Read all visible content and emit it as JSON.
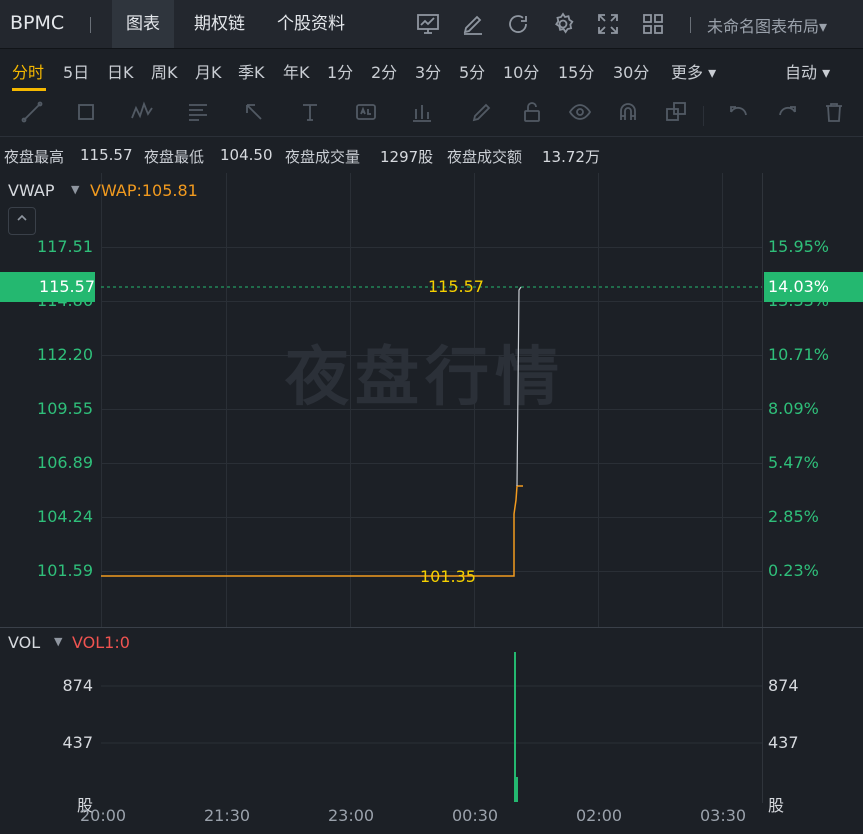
{
  "topbar": {
    "ticker": "BPMC",
    "tabs": [
      "图表",
      "期权链",
      "个股资料"
    ],
    "layout_name": "未命名图表布局▾",
    "icons": [
      "chart-template-icon",
      "edit-icon",
      "refresh-icon",
      "settings-icon",
      "fullscreen-icon",
      "layout-grid-icon"
    ]
  },
  "periods": {
    "items": [
      "分时",
      "5日",
      "日K",
      "周K",
      "月K",
      "季K",
      "年K",
      "1分",
      "2分",
      "3分",
      "5分",
      "10分",
      "15分",
      "30分",
      "更多 ▾"
    ],
    "active": "分时",
    "scale_mode": "自动 ▾"
  },
  "drawing_tools": [
    "line-tool-icon",
    "rectangle-tool-icon",
    "pattern-tool-icon",
    "fibonacci-tool-icon",
    "arrow-tool-icon",
    "text-tool-icon",
    "annotation-tool-icon",
    "measure-tool-icon",
    "brush-tool-icon",
    "lock-icon",
    "eye-icon",
    "magnet-icon",
    "clone-icon",
    "undo-icon",
    "redo-icon",
    "delete-icon"
  ],
  "night_session": {
    "high_label": "夜盘最高",
    "high": "115.57",
    "low_label": "夜盘最低",
    "low": "104.50",
    "volume_label": "夜盘成交量",
    "volume": "1297股",
    "turnover_label": "夜盘成交额",
    "turnover": "13.72万"
  },
  "main_panel": {
    "indicator": "VWAP",
    "indicator_value": "VWAP:105.81",
    "watermark": "夜盘行情",
    "price_labels": [
      "117.51",
      "114.86",
      "112.20",
      "109.55",
      "106.89",
      "104.24",
      "101.59"
    ],
    "pct_labels": [
      "15.95%",
      "13.33%",
      "10.71%",
      "8.09%",
      "5.47%",
      "2.85%",
      "0.23%"
    ],
    "current_price": "115.57",
    "current_pct": "14.03%",
    "high_marker": "115.57",
    "low_marker": "101.35"
  },
  "volume_panel": {
    "indicator": "VOL",
    "indicator_value": "VOL1:0",
    "labels": [
      "874",
      "437",
      "股"
    ]
  },
  "time_axis": [
    "20:00",
    "21:30",
    "23:00",
    "00:30",
    "02:00",
    "03:30"
  ],
  "colors": {
    "background": "#1c2026",
    "up": "#24b870",
    "price_line": "#f19a1f",
    "active_period": "#f5b800",
    "marker_text": "#f5d000"
  },
  "chart_data": {
    "type": "line",
    "x": [
      "20:00",
      "00:50",
      "00:51",
      "00:51",
      "00:52"
    ],
    "price": [
      101.35,
      101.35,
      104.5,
      105.81,
      105.81
    ],
    "high": 115.57,
    "y_ticks": [
      101.59,
      104.24,
      106.89,
      109.55,
      112.2,
      114.86,
      117.51
    ],
    "volume_ticks": [
      437,
      874
    ]
  }
}
